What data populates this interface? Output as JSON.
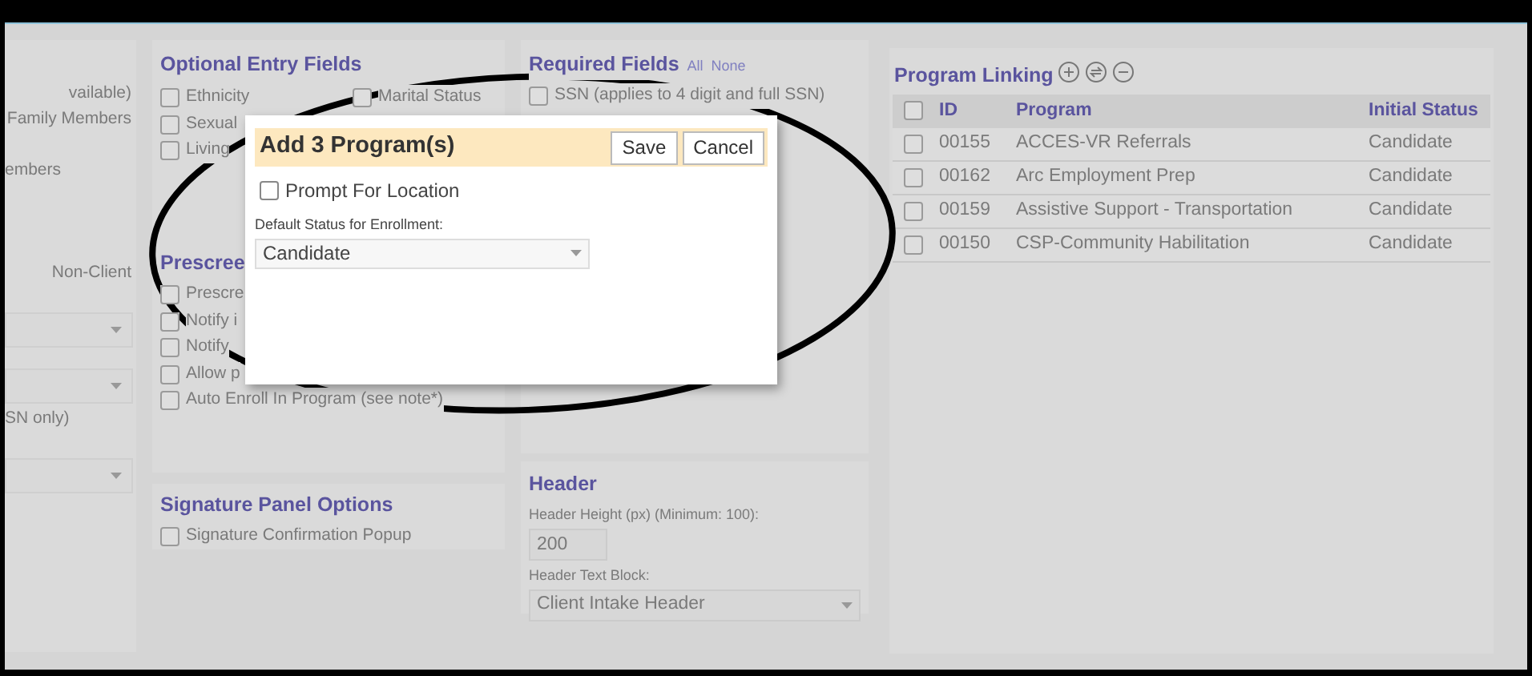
{
  "left_panel": {
    "items": [
      {
        "kind": "text",
        "label": "vailable)"
      },
      {
        "kind": "text",
        "label": "Family Members"
      },
      {
        "kind": "text",
        "label": "embers"
      },
      {
        "kind": "text",
        "label": "Non-Client"
      },
      {
        "kind": "select"
      },
      {
        "kind": "select"
      },
      {
        "kind": "text",
        "label": "SN only)"
      },
      {
        "kind": "select"
      }
    ]
  },
  "optional_entry_fields": {
    "title": "Optional Entry Fields",
    "rows": [
      [
        {
          "label": "Ethnicity",
          "checked": false
        },
        {
          "label": "Marital Status",
          "checked": false
        }
      ],
      [
        {
          "label": "Sexual",
          "checked": false
        }
      ],
      [
        {
          "label": "Living",
          "checked": false
        }
      ]
    ]
  },
  "prescreen": {
    "title": "Prescree",
    "items": [
      {
        "label": "Prescre",
        "checked": false
      },
      {
        "label": "Notify i",
        "checked": false
      },
      {
        "label": "Notify",
        "checked": false
      },
      {
        "label": "Allow p",
        "checked": false
      },
      {
        "label": "Auto Enroll In Program (see note*)",
        "checked": false
      }
    ]
  },
  "signature_panel_options": {
    "title": "Signature Panel Options",
    "items": [
      {
        "label": "Signature Confirmation Popup",
        "checked": false
      }
    ]
  },
  "required_fields": {
    "title": "Required Fields",
    "links": [
      "All",
      "None"
    ],
    "items": [
      {
        "label": "SSN (applies to 4 digit and full SSN)",
        "checked": false
      }
    ]
  },
  "header": {
    "title": "Header",
    "height_label": "Header Height (px) (Minimum: 100):",
    "height_value": "200",
    "text_block_label": "Header Text Block:",
    "text_block_value": "Client Intake Header"
  },
  "program_linking": {
    "title": "Program Linking",
    "table": {
      "header_checked": false,
      "columns": [
        "ID",
        "Program",
        "Initial Status"
      ],
      "rows": [
        {
          "checked": false,
          "cells": [
            "00155",
            "ACCES-VR Referrals",
            "Candidate"
          ]
        },
        {
          "checked": false,
          "cells": [
            "00162",
            "Arc Employment Prep",
            "Candidate"
          ]
        },
        {
          "checked": false,
          "cells": [
            "00159",
            "Assistive Support - Transportation",
            "Candidate"
          ]
        },
        {
          "checked": false,
          "cells": [
            "00150",
            "CSP-Community Habilitation",
            "Candidate"
          ]
        }
      ]
    }
  },
  "dialog": {
    "title": "Add 3 Program(s)",
    "buttons": [
      "Save",
      "Cancel"
    ],
    "prompt_for_location": {
      "label": "Prompt For Location",
      "checked": false
    },
    "status_label": "Default Status for Enrollment:",
    "status_value": "Candidate"
  }
}
